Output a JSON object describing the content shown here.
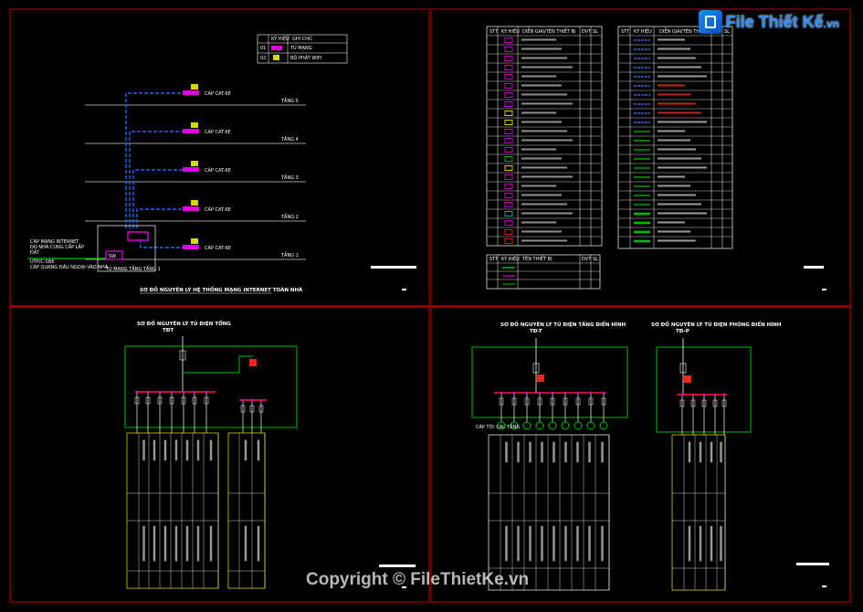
{
  "watermark": {
    "site_name": "File Thiết Kế",
    "site_domain": ".vn",
    "copyright": "Copyright © FileThietKe.vn"
  },
  "network_diagram": {
    "title": "SƠ ĐỒ NGUYÊN LÝ HỆ THỐNG MẠNG INTERNET TOÀN NHÀ",
    "floors": [
      "TẦNG 5",
      "TẦNG 4",
      "TẦNG 3",
      "TẦNG 2",
      "TẦNG 1"
    ],
    "cable_labels": [
      "CÁP CAT-6E",
      "CÁP CAT-6E",
      "CÁP CAT-6E",
      "CÁP CAT-6E",
      "CÁP CAT-6E"
    ],
    "cabinet_label": "TỦ MẠNG TẦNG TẦNG 1",
    "switch_label": "SW",
    "incoming_labels": [
      "CÁP MẠNG INTERNET",
      "DO NHÀ CUNG CẤP LẮP",
      "ĐẶT",
      "UTP/C-5BE",
      "CÁP QUANG ĐẦU NGOẠI VÀO NHÀ"
    ],
    "legend_headers": [
      "KÝ HIỆU",
      "GHI CHÚ"
    ],
    "legend_rows": [
      {
        "no": "01",
        "name": "TỦ MẠNG"
      },
      {
        "no": "02",
        "name": "BỘ PHÁT WIFI"
      }
    ]
  },
  "legend_tables": {
    "symbols_headers": [
      "STT",
      "KÝ HIỆU",
      "DIỄN GIẢI/TÊN THIẾT BỊ",
      "ĐVT",
      "SL"
    ],
    "cables_headers": [
      "STT",
      "KÝ HIỆU",
      "DIỄN GIẢI/TÊN THIẾT BỊ",
      "ĐVT",
      "SL"
    ],
    "extra_headers": [
      "STT",
      "KÝ HIỆU",
      "TÊN THIẾT BỊ",
      "ĐVT",
      "SL"
    ]
  },
  "panel_main": {
    "title": "SƠ ĐỒ NGUYÊN LÝ TỦ ĐIỆN TỔNG",
    "code": "TĐT",
    "row_labels": [
      "TÊN PHỤ TẢI",
      "CÔNG SUẤT",
      "DÂY DẪN",
      "TUYẾN"
    ]
  },
  "panel_floor": {
    "title": "SƠ ĐỒ NGUYÊN LÝ TỦ ĐIỆN TẦNG ĐIỂN HÌNH",
    "code": "TĐ-T",
    "outgoing": "CÁP TỚI CÁC TẦNG"
  },
  "panel_room": {
    "title": "SƠ ĐỒ NGUYÊN LÝ TỦ ĐIỆN PHÒNG ĐIỂN HÌNH",
    "code": "TĐ-P"
  }
}
